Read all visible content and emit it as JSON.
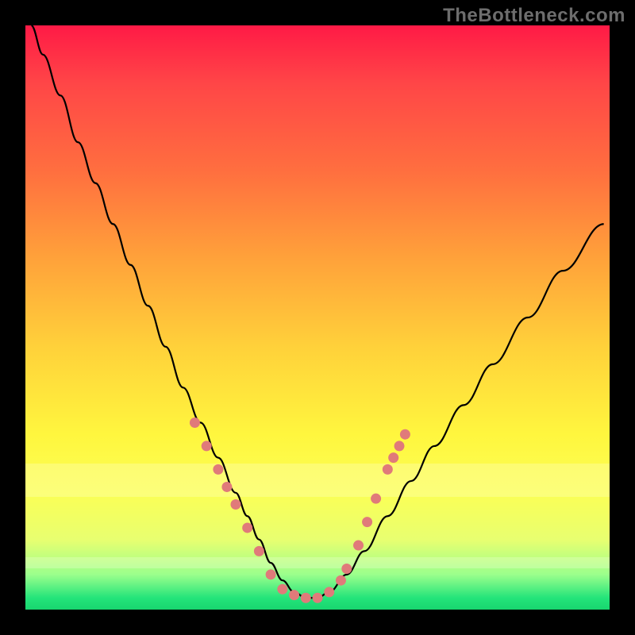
{
  "watermark": "TheBottleneck.com",
  "colors": {
    "frame": "#000000",
    "gradient_top": "#ff1a46",
    "gradient_bottom": "#18d66f",
    "curve": "#000000",
    "marker": "#e07a7a"
  },
  "chart_data": {
    "type": "line",
    "title": "",
    "xlabel": "",
    "ylabel": "",
    "xlim": [
      0,
      100
    ],
    "ylim": [
      0,
      100
    ],
    "series": [
      {
        "name": "curve",
        "x": [
          1,
          3,
          6,
          9,
          12,
          15,
          18,
          21,
          24,
          27,
          30,
          33,
          36,
          38,
          40,
          42,
          44,
          46,
          48,
          50,
          52,
          55,
          58,
          62,
          66,
          70,
          75,
          80,
          86,
          92,
          99
        ],
        "y": [
          100,
          95,
          88,
          80,
          73,
          66,
          59,
          52,
          45,
          38,
          32,
          26,
          20,
          16,
          12,
          8,
          5,
          3,
          2,
          2,
          3,
          6,
          10,
          16,
          22,
          28,
          35,
          42,
          50,
          58,
          66
        ]
      }
    ],
    "markers": [
      {
        "x": 29,
        "y": 32
      },
      {
        "x": 31,
        "y": 28
      },
      {
        "x": 33,
        "y": 24
      },
      {
        "x": 34.5,
        "y": 21
      },
      {
        "x": 36,
        "y": 18
      },
      {
        "x": 38,
        "y": 14
      },
      {
        "x": 40,
        "y": 10
      },
      {
        "x": 42,
        "y": 6
      },
      {
        "x": 44,
        "y": 3.5
      },
      {
        "x": 46,
        "y": 2.5
      },
      {
        "x": 48,
        "y": 2
      },
      {
        "x": 50,
        "y": 2
      },
      {
        "x": 52,
        "y": 3
      },
      {
        "x": 54,
        "y": 5
      },
      {
        "x": 55,
        "y": 7
      },
      {
        "x": 57,
        "y": 11
      },
      {
        "x": 58.5,
        "y": 15
      },
      {
        "x": 60,
        "y": 19
      },
      {
        "x": 62,
        "y": 24
      },
      {
        "x": 63,
        "y": 26
      },
      {
        "x": 64,
        "y": 28
      },
      {
        "x": 65,
        "y": 30
      }
    ]
  }
}
